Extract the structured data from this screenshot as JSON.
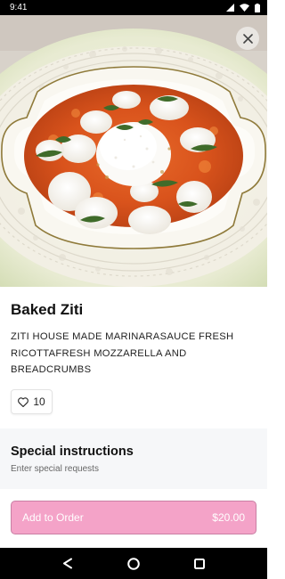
{
  "status_bar": {
    "time": "9:41"
  },
  "item": {
    "title": "Baked Ziti",
    "description": "ZITI HOUSE MADE MARINARASAUCE FRESH RICOTTAFRESH MOZZARELLA AND BREADCRUMBS",
    "like_count": "10"
  },
  "special_instructions": {
    "title": "Special instructions",
    "placeholder": "Enter special requests"
  },
  "footer": {
    "add_label": "Add to Order",
    "price": "$20.00"
  },
  "colors": {
    "accent": "#f4a3c8",
    "accent_border": "#c97fa4"
  },
  "icons": {
    "close": "close-icon",
    "like": "heart-icon",
    "nav_back": "back-triangle-icon",
    "nav_home": "home-circle-icon",
    "nav_recents": "recents-square-icon"
  }
}
